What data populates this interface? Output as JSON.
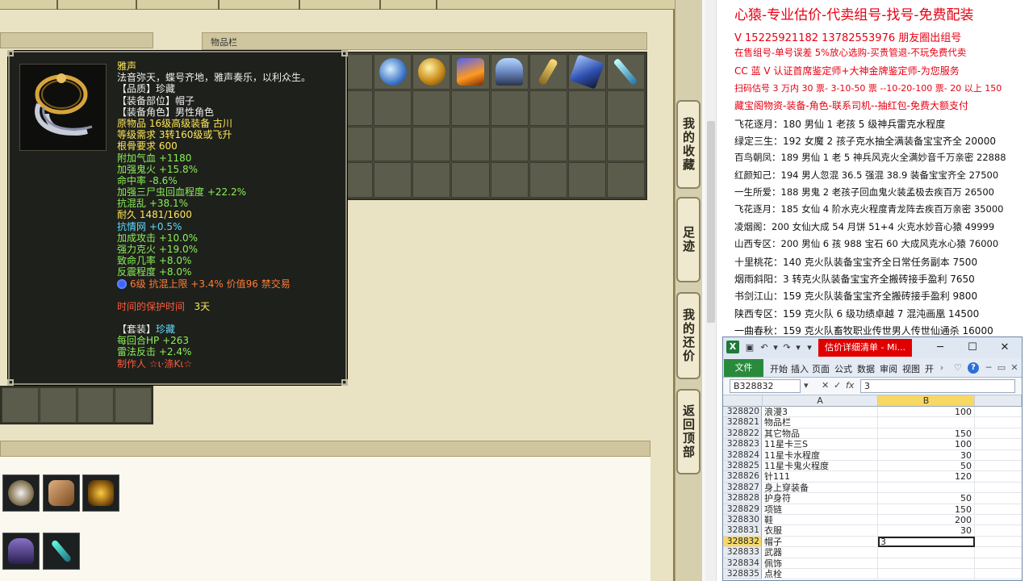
{
  "game": {
    "items_panel_title": "物品栏",
    "side_buttons": [
      "我的收藏",
      "足迹",
      "我的还价",
      "返回顶部"
    ]
  },
  "tooltip": {
    "lines": [
      {
        "text": "雅声",
        "color": "yellow"
      },
      {
        "text": "法音弥天，蝶号齐地，雅声奏乐，以利众生。",
        "color": "white"
      },
      {
        "text": "【品质】珍藏",
        "color": "white"
      },
      {
        "text": "【装备部位】帽子",
        "color": "white"
      },
      {
        "text": "【装备角色】男性角色",
        "color": "white"
      },
      {
        "text": "原物品 16级高级装备 古川",
        "color": "yellow"
      },
      {
        "text": "等级需求 3转160级或飞升",
        "color": "yellow"
      },
      {
        "text": "根骨要求 600",
        "color": "yellow"
      },
      {
        "text": "附加气血 +1180",
        "color": "green"
      },
      {
        "text": "加强鬼火 +15.8%",
        "color": "green"
      },
      {
        "text": "命中率 -8.6%",
        "color": "green"
      },
      {
        "text": "加强三尸虫回血程度 +22.2%",
        "color": "green"
      },
      {
        "text": "抗混乱 +38.1%",
        "color": "green"
      },
      {
        "text": "耐久 1481/1600",
        "color": "yellow"
      },
      {
        "text": "抗情网 +0.5%",
        "color": "cyan"
      },
      {
        "text": "加成攻击 +10.0%",
        "color": "green"
      },
      {
        "text": "强力克火 +19.0%",
        "color": "green"
      },
      {
        "text": "致命几率 +8.0%",
        "color": "green"
      },
      {
        "text": "反震程度 +8.0%",
        "color": "green"
      }
    ],
    "gem_line": "6级 抗混上限 +3.4% 价值96 禁交易",
    "protect_label": "时间的保护时间",
    "protect_value": "3天",
    "set_label": "【套装】",
    "set_value": "珍藏",
    "set_lines": [
      "每回合HP +263",
      "雷法反击 +2.4%"
    ],
    "maker": "制作人 ☆ι·涤Kι☆"
  },
  "ad": {
    "lines": [
      {
        "text": "心猿-专业估价-代卖组号-找号-免费配装",
        "color": "red",
        "size": 17
      },
      {
        "text": "V 15225921182   13782553976 朋友圈出组号",
        "color": "red",
        "size": 13
      },
      {
        "text": "在售组号-单号误差 5%放心选购-买贵管退-不玩免费代卖",
        "color": "red",
        "size": 11.5
      },
      {
        "text": "CC 蓝 V 认证首席鉴定师+大神金牌鉴定师-为您服务",
        "color": "red",
        "size": 12
      },
      {
        "text": "扫码估号 3 万内 30 票- 3-10-50 票  --10-20-100 票- 20 以上 150",
        "color": "red",
        "size": 11
      },
      {
        "text": "藏宝阁物资-装备-角色-联系司机--抽红包-免费大额支付",
        "color": "red",
        "size": 12
      },
      {
        "text": "飞花逐月：180 男仙 1 老孩 5 级神兵雷克水程度",
        "color": "black",
        "size": 12
      },
      {
        "text": "绿定三生：192 女魔 2 孩子克水抽全满装备宝宝齐全 20000",
        "color": "black",
        "size": 12
      },
      {
        "text": "百鸟朝凤：189 男仙 1 老 5 神兵风克火全满妙音千万亲密 22888",
        "color": "black",
        "size": 11.5
      },
      {
        "text": "红颜知己：194 男人忽混 36.5 强混 38.9 装备宝宝齐全 27500",
        "color": "black",
        "size": 11.5
      },
      {
        "text": "一生所爱：188 男鬼 2 老孩子回血鬼火装孟极去疾百万 26500",
        "color": "black",
        "size": 11.5
      },
      {
        "text": "飞花逐月：185 女仙 4 阶水克火程度青龙阵去疾百万亲密 35000",
        "color": "black",
        "size": 11.5
      },
      {
        "text": "凌烟阁：200 女仙大成 54 月饼 51+4 火克水妙音心猿 49999",
        "color": "black",
        "size": 11.5
      },
      {
        "text": "山西专区：200 男仙 6 孩 988 宝石 60 大成风克水心猿 76000",
        "color": "black",
        "size": 11.5
      },
      {
        "text": "十里桃花：140 克火队装备宝宝齐全日常任务副本 7500",
        "color": "black",
        "size": 12
      },
      {
        "text": "烟雨斜阳：3 转克火队装备宝宝齐全搬砖接手盈利 7650",
        "color": "black",
        "size": 12
      },
      {
        "text": "书剑江山：159 克火队装备宝宝齐全搬砖接手盈利 9800",
        "color": "black",
        "size": 12
      },
      {
        "text": "陕西专区：159 克火队 6 级功绩卓越 7 混沌画凰 14500",
        "color": "black",
        "size": 12
      },
      {
        "text": "一曲春秋：159 克火队畜牧职业传世男人传世仙通杀 16000",
        "color": "black",
        "size": 12
      }
    ]
  },
  "excel": {
    "title": "估价详细清单 - Mi...",
    "file_tab": "文件",
    "tabs": [
      "开始",
      "插入",
      "页面",
      "公式",
      "数据",
      "审阅",
      "视图",
      "开"
    ],
    "name_box": "B328832",
    "formula_value": "3",
    "col_headers": [
      "A",
      "B"
    ],
    "rows": [
      {
        "num": "328820",
        "a": "浪漫3",
        "b": "100"
      },
      {
        "num": "328821",
        "a": "物品栏",
        "b": ""
      },
      {
        "num": "328822",
        "a": "其它物品",
        "b": "150"
      },
      {
        "num": "328823",
        "a": "11星卡三S",
        "b": "100"
      },
      {
        "num": "328824",
        "a": "11星卡水程度",
        "b": "30"
      },
      {
        "num": "328825",
        "a": "11星卡鬼火程度",
        "b": "50"
      },
      {
        "num": "328826",
        "a": "针111",
        "b": "120"
      },
      {
        "num": "328827",
        "a": "身上穿装备",
        "b": ""
      },
      {
        "num": "328828",
        "a": "护身符",
        "b": "50"
      },
      {
        "num": "328829",
        "a": "项链",
        "b": "150"
      },
      {
        "num": "328830",
        "a": "鞋",
        "b": "200"
      },
      {
        "num": "328831",
        "a": "衣服",
        "b": "30"
      },
      {
        "num": "328832",
        "a": "帽子",
        "b": "3"
      },
      {
        "num": "328833",
        "a": "武器",
        "b": ""
      },
      {
        "num": "328834",
        "a": "佩饰",
        "b": ""
      },
      {
        "num": "328835",
        "a": "点栓",
        "b": ""
      }
    ],
    "selected_row": "328832"
  },
  "colors": {
    "tooltip_bg": "#1e201b",
    "ad_red": "#e60012",
    "excel_green": "#2a8a3c",
    "title_red": "#e00000"
  }
}
